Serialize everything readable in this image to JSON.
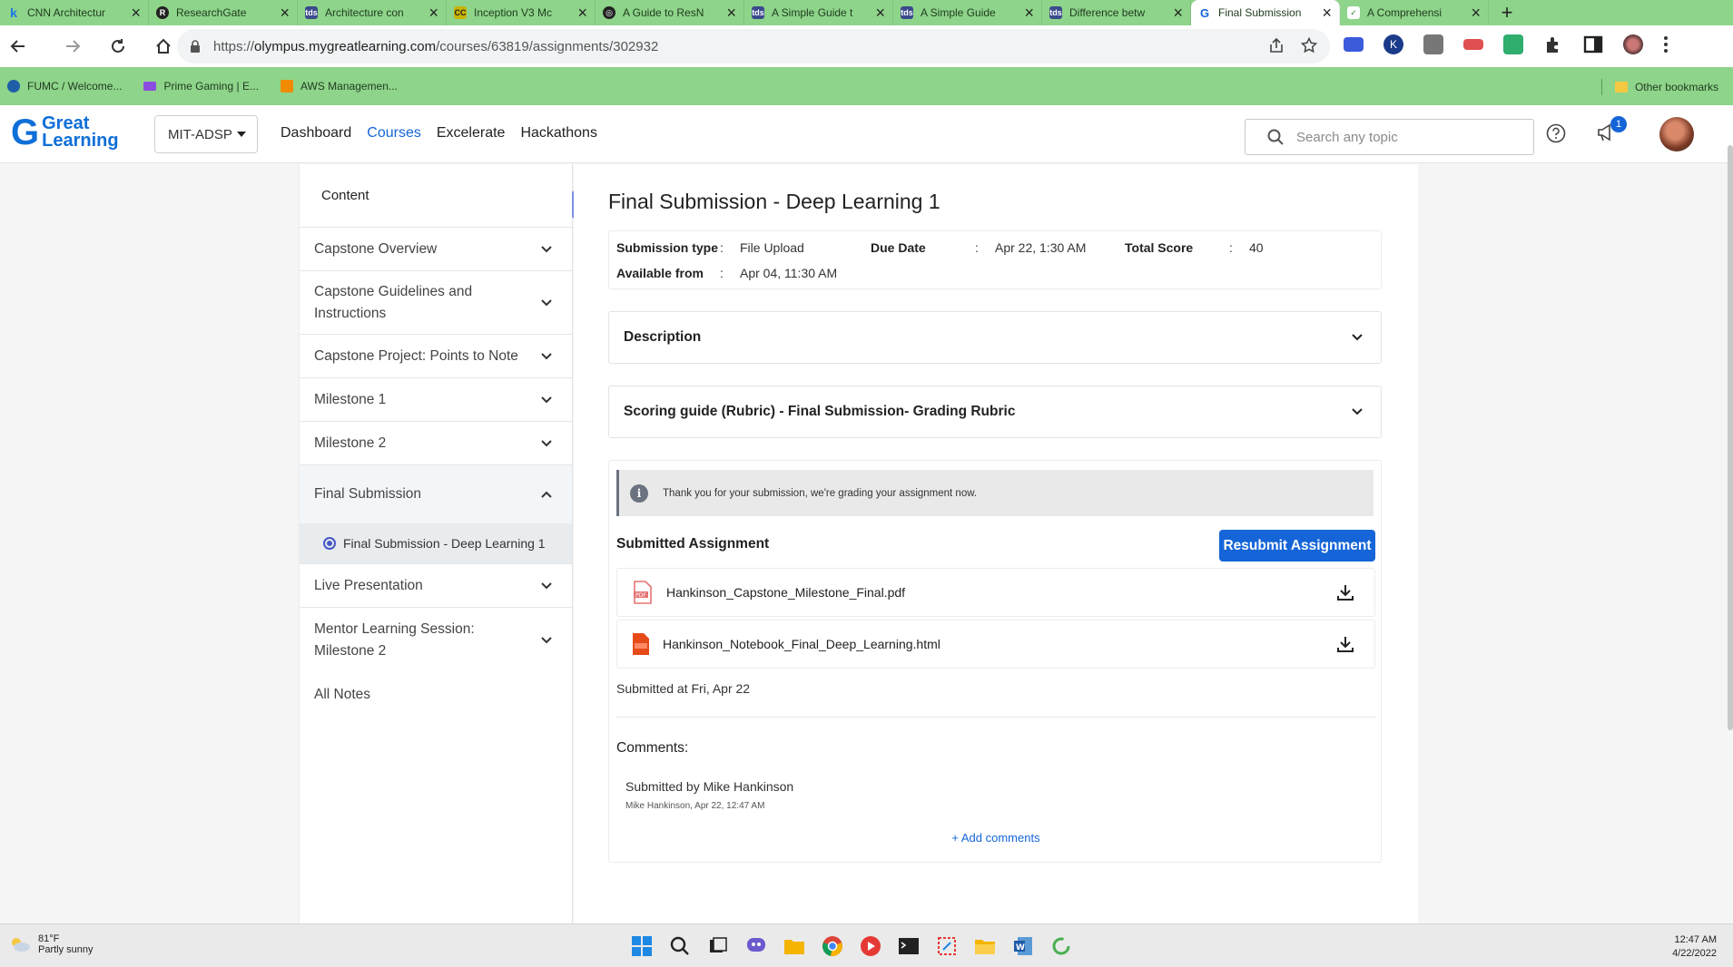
{
  "browser": {
    "tabs": [
      {
        "title": "CNN Architectur",
        "icon": "k-icon",
        "color": "#1a73e8"
      },
      {
        "title": "ResearchGate",
        "icon": "researchgate-icon",
        "color": "#222222"
      },
      {
        "title": "Architecture con",
        "icon": "tds-icon",
        "color": "#3a4a8c"
      },
      {
        "title": "Inception V3 Mc",
        "icon": "cc-icon",
        "color": "#c9b400"
      },
      {
        "title": "A Guide to ResN",
        "icon": "openai-icon",
        "color": "#222222"
      },
      {
        "title": "A Simple Guide t",
        "icon": "tds-icon",
        "color": "#3a4a8c"
      },
      {
        "title": "A Simple Guide",
        "icon": "tds-icon",
        "color": "#3a4a8c"
      },
      {
        "title": "Difference betw",
        "icon": "tds-icon",
        "color": "#3a4a8c"
      },
      {
        "title": "Final Submission",
        "icon": "g-icon",
        "color": "#1565d8",
        "active": true
      },
      {
        "title": "A Comprehensi",
        "icon": "chart-icon",
        "color": "#2e7d32"
      }
    ],
    "url_prefix": "https://",
    "url_host": "olympus.mygreatlearning.com",
    "url_path": "/courses/63819/assignments/302932",
    "bookmarks": [
      {
        "label": "FUMC / Welcome...",
        "color": "#1f5fa8"
      },
      {
        "label": "Prime Gaming | E...",
        "color": "#8a4de0"
      },
      {
        "label": "AWS Managemen...",
        "color": "#f08a00"
      }
    ],
    "other_bookmarks": "Other bookmarks"
  },
  "header": {
    "logo_line1": "Great",
    "logo_line2": "Learning",
    "program": "MIT-ADSP",
    "nav": [
      "Dashboard",
      "Courses",
      "Excelerate",
      "Hackathons"
    ],
    "active_nav": "Courses",
    "search_placeholder": "Search any topic",
    "notification_count": "1"
  },
  "sidebar": {
    "heading": "Content",
    "items": [
      {
        "label": "Capstone Overview"
      },
      {
        "label": "Capstone Guidelines and Instructions"
      },
      {
        "label": "Capstone Project: Points to Note"
      },
      {
        "label": "Milestone 1"
      },
      {
        "label": "Milestone 2"
      },
      {
        "label": "Final Submission",
        "expanded": true
      },
      {
        "label": "Live Presentation"
      },
      {
        "label": "Mentor Learning Session: Milestone 2"
      }
    ],
    "sub_item": "Final Submission - Deep Learning 1",
    "all_notes": "All Notes"
  },
  "assignment": {
    "title": "Final Submission - Deep Learning 1",
    "info": {
      "submission_type_label": "Submission type",
      "submission_type": "File Upload",
      "due_date_label": "Due Date",
      "due_date": "Apr 22, 1:30 AM",
      "total_score_label": "Total Score",
      "total_score": "40",
      "available_from_label": "Available from",
      "available_from": "Apr 04, 11:30 AM",
      "sep": ":"
    },
    "description_label": "Description",
    "rubric_label": "Scoring guide (Rubric) - Final Submission- Grading Rubric",
    "notice": "Thank you for your submission, we're grading your assignment now.",
    "submitted_heading": "Submitted Assignment",
    "resubmit_label": "Resubmit Assignment",
    "files": [
      {
        "name": "Hankinson_Capstone_Milestone_Final.pdf",
        "icon": "pdf-file-icon",
        "color": "#e57373"
      },
      {
        "name": "Hankinson_Notebook_Final_Deep_Learning.html",
        "icon": "html-file-icon",
        "color": "#e64a19"
      }
    ],
    "submitted_at": "Submitted at Fri, Apr 22",
    "comments_heading": "Comments:",
    "comment_text": "Submitted by Mike Hankinson",
    "comment_meta": "Mike Hankinson, Apr 22, 12:47 AM",
    "add_comments": "+ Add comments"
  },
  "taskbar": {
    "temperature": "81°F",
    "weather": "Partly sunny",
    "time": "12:47 AM",
    "date": "4/22/2022"
  },
  "colors": {
    "accent": "#1565d8",
    "browser_frame": "#8ed48a",
    "collapse_btn": "#7b8ee6"
  }
}
